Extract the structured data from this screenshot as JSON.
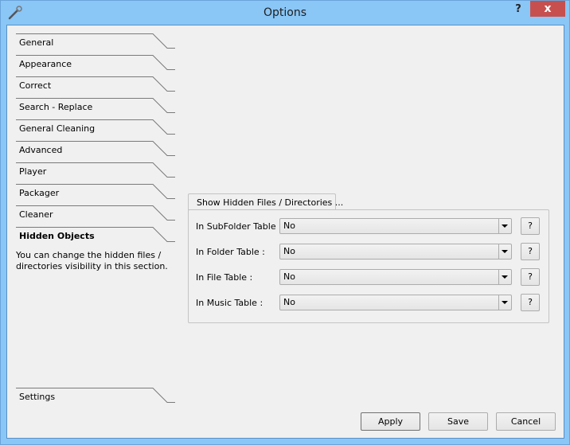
{
  "window": {
    "title": "Options",
    "help_label": "?",
    "close_label": "x"
  },
  "sidebar": {
    "items": [
      {
        "label": "General"
      },
      {
        "label": "Appearance"
      },
      {
        "label": "Correct"
      },
      {
        "label": "Search - Replace"
      },
      {
        "label": "General Cleaning"
      },
      {
        "label": "Advanced"
      },
      {
        "label": "Player"
      },
      {
        "label": "Packager"
      },
      {
        "label": "Cleaner"
      },
      {
        "label": "Hidden Objects",
        "active": true
      }
    ],
    "description": "You can change the hidden files / directories visibility in this section.",
    "settings_label": "Settings"
  },
  "panel": {
    "group_title": "Show Hidden Files / Directories ...",
    "rows": [
      {
        "label": "In SubFolder Table :",
        "value": "No",
        "help": "?"
      },
      {
        "label": "In Folder Table :",
        "value": "No",
        "help": "?"
      },
      {
        "label": "In File Table :",
        "value": "No",
        "help": "?"
      },
      {
        "label": "In Music Table :",
        "value": "No",
        "help": "?"
      }
    ]
  },
  "footer": {
    "apply_label": "Apply",
    "save_label": "Save",
    "cancel_label": "Cancel"
  },
  "colors": {
    "frame": "#8ac6f6",
    "close": "#c7504f",
    "client": "#f0f0f0"
  }
}
